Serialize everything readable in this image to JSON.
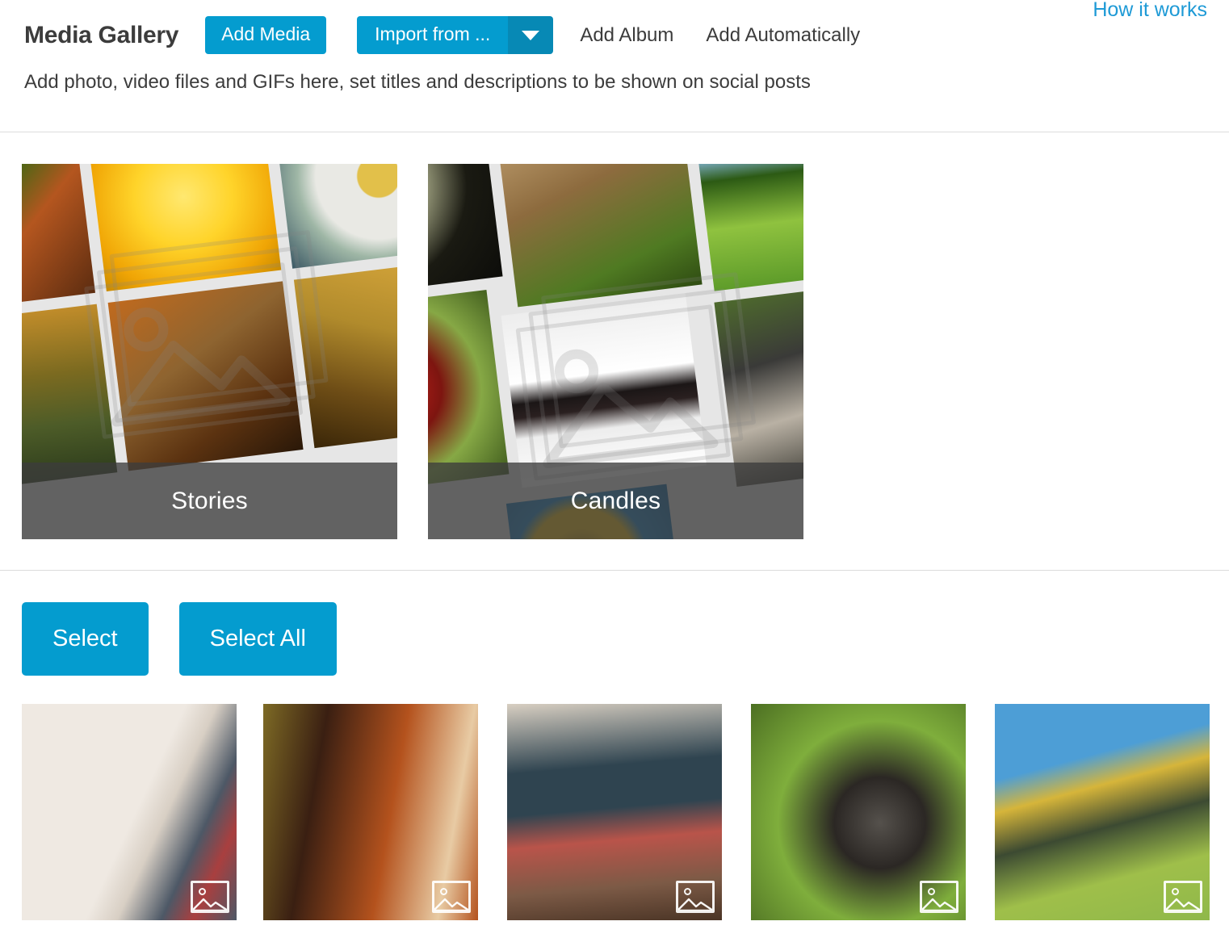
{
  "header": {
    "title": "Media Gallery",
    "add_media_label": "Add Media",
    "import_from_label": "Import from ...",
    "import_caret_icon": "chevron-down-icon",
    "add_album_label": "Add Album",
    "add_automatically_label": "Add Automatically",
    "how_it_works_label": "How it works",
    "subtitle": "Add photo, video files and GIFs here, set titles and descriptions to be shown on social posts"
  },
  "colors": {
    "accent_blue": "#049CCF",
    "accent_blue_dark": "#0789B5",
    "link_blue": "#1e9ad6",
    "text_dark": "#3c3c3c",
    "divider": "#dcdcdc",
    "album_bg": "#e6e6e6",
    "caption_overlay": "rgba(60,60,60,0.78)"
  },
  "albums": [
    {
      "name": "Stories",
      "watermark_icon": "multi-image-placeholder-icon",
      "tiles": [
        {
          "label": "butterfly-on-leaf",
          "c1": "#6aa226",
          "c2": "#2f6b12",
          "c3": "#b4561f",
          "c4": "#5c2c10"
        },
        {
          "label": "yellow-dandelion-closeup",
          "c1": "#ffd42a",
          "c2": "#f0a505",
          "c3": "#ffe870",
          "c4": "#c88a00"
        },
        {
          "label": "white-daisy-flower",
          "c1": "#e9e9e4",
          "c2": "#9fb7a6",
          "c3": "#e2c04a",
          "c4": "#33505f"
        },
        {
          "label": "misty-forest-sunrise",
          "c1": "#c08c2a",
          "c2": "#4d5c28",
          "c3": "#2e3d1c",
          "c4": "#7b6a20"
        },
        {
          "label": "squirrel-with-basket",
          "c1": "#c06a1e",
          "c2": "#5b3210",
          "c3": "#8e6430",
          "c4": "#2a1808"
        },
        {
          "label": "wheat-ears-golden-field",
          "c1": "#d9a83c",
          "c2": "#6e4d16",
          "c3": "#3a2608",
          "c4": "#b18b2c"
        }
      ]
    },
    {
      "name": "Candles",
      "watermark_icon": "multi-image-placeholder-icon",
      "tiles": [
        {
          "label": "white-elderflower-blossom",
          "c1": "#0d0d0a",
          "c2": "#e9e6cf",
          "c3": "#cfd2a8",
          "c4": "#1a1a12"
        },
        {
          "label": "goslings-on-grass",
          "c1": "#8d6b3e",
          "c2": "#4f7a22",
          "c3": "#c9a97a",
          "c4": "#2f4c12"
        },
        {
          "label": "green-meadow-with-tree",
          "c1": "#86b8dc",
          "c2": "#5e9c2a",
          "c3": "#2c5a14",
          "c4": "#8fc23f"
        },
        {
          "label": "red-lily-flower",
          "c1": "#c8211c",
          "c2": "#7d1510",
          "c3": "#86a845",
          "c4": "#3e5a1c"
        },
        {
          "label": "tree-silhouette-reflection",
          "c1": "#ededed",
          "c2": "#1b1616",
          "c3": "#ffffff",
          "c4": "#2a2020"
        },
        {
          "label": "outdoor-cafe-terrace",
          "c1": "#4e6a2d",
          "c2": "#3a3a38",
          "c3": "#b9b1a4",
          "c4": "#25251f"
        },
        {
          "label": "sunflower-against-blue-sky",
          "c1": "#1f86c8",
          "c2": "#f2c013",
          "c3": "#8a6a1a",
          "c4": "#0f64a0"
        }
      ]
    }
  ],
  "toolbar": {
    "select_label": "Select",
    "select_all_label": "Select All"
  },
  "media_items": [
    {
      "label": "books-and-glasses-on-sofa",
      "badge_icon": "image-icon",
      "c1": "#efe9e2",
      "c2": "#d8cfc4",
      "c3": "#a93f3f",
      "c4": "#4d5866"
    },
    {
      "label": "red-panda-on-tree",
      "badge_icon": "image-icon",
      "c1": "#7d6a25",
      "c2": "#b4521d",
      "c3": "#3a1f12",
      "c4": "#e8cba4"
    },
    {
      "label": "stack-of-old-books",
      "badge_icon": "image-icon",
      "c1": "#d8cfc2",
      "c2": "#2f4450",
      "c3": "#7c5a46",
      "c4": "#b9544a"
    },
    {
      "label": "squirrel-on-branch",
      "badge_icon": "image-icon",
      "c1": "#7fae3c",
      "c2": "#4c6f22",
      "c3": "#55514c",
      "c4": "#2b2724"
    },
    {
      "label": "frog-on-lily-pad",
      "badge_icon": "image-icon",
      "c1": "#4d9ed6",
      "c2": "#9fbf4a",
      "c3": "#3c4a32",
      "c4": "#d6b53a"
    }
  ]
}
